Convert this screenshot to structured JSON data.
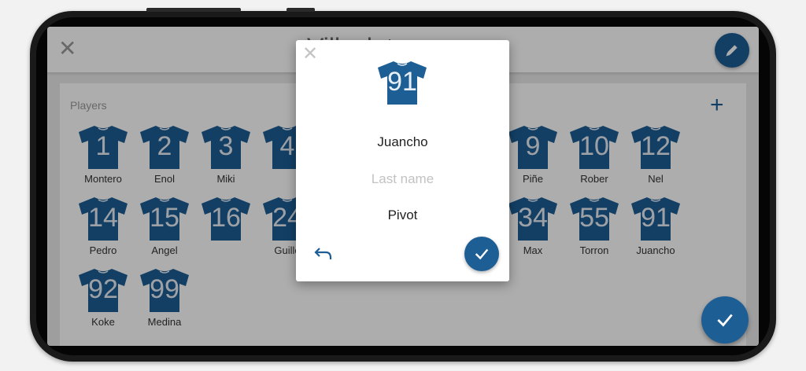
{
  "header": {
    "title": "Villaclat"
  },
  "players_section": {
    "label": "Players",
    "players": [
      {
        "number": "1",
        "name": "Montero"
      },
      {
        "number": "2",
        "name": "Enol"
      },
      {
        "number": "3",
        "name": "Miki"
      },
      {
        "number": "4",
        "name": ""
      },
      {
        "number": "9",
        "name": "Piñe"
      },
      {
        "number": "10",
        "name": "Rober"
      },
      {
        "number": "12",
        "name": "Nel"
      },
      {
        "number": "14",
        "name": "Pedro"
      },
      {
        "number": "15",
        "name": "Angel"
      },
      {
        "number": "16",
        "name": ""
      },
      {
        "number": "24",
        "name": "Guille"
      },
      {
        "number": "34",
        "name": "Max"
      },
      {
        "number": "55",
        "name": "Torron"
      },
      {
        "number": "91",
        "name": "Juancho"
      },
      {
        "number": "92",
        "name": "Koke"
      },
      {
        "number": "99",
        "name": "Medina"
      }
    ]
  },
  "dialog": {
    "number": "91",
    "first_name": "Juancho",
    "last_name_placeholder": "Last name",
    "position": "Pivot"
  },
  "icons": {
    "close": "close-icon",
    "edit": "pencil-icon",
    "add": "plus-icon",
    "undo": "undo-icon",
    "confirm": "check-icon"
  },
  "colors": {
    "accent": "#1d5e95",
    "shirt": "#1d5e95",
    "shirt_number": "#e8eef5"
  }
}
